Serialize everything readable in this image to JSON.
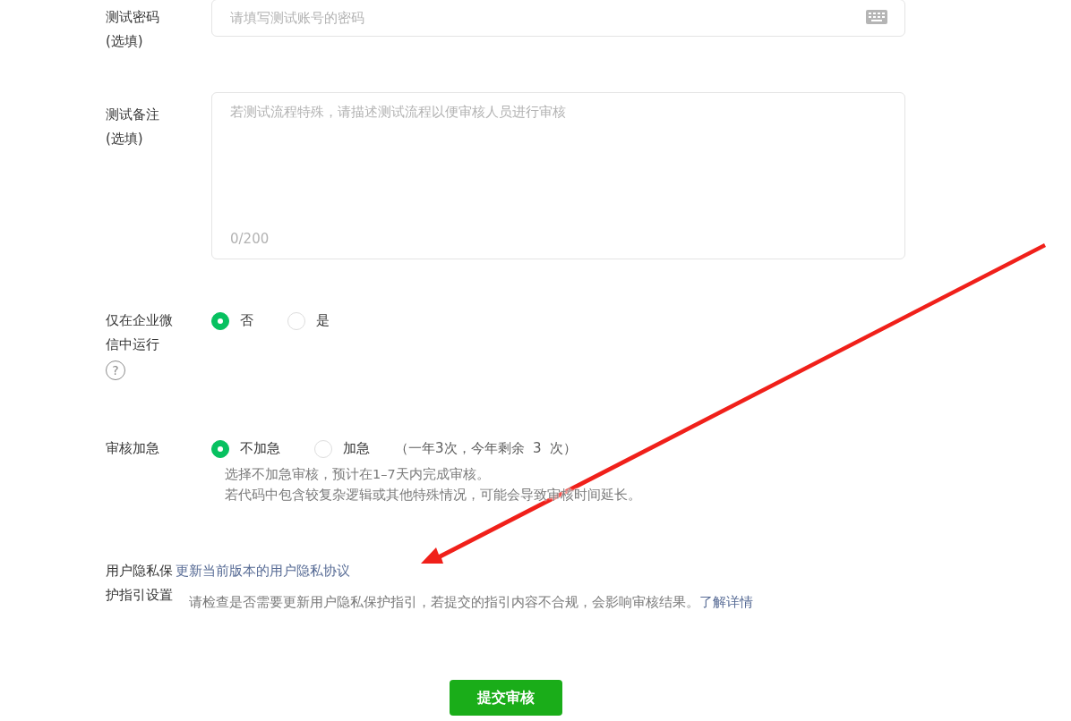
{
  "password": {
    "label": "测试密码\n(选填)",
    "placeholder": "请填写测试账号的密码"
  },
  "notes": {
    "label": "测试备注\n(选填)",
    "placeholder": "若测试流程特殊，请描述测试流程以便审核人员进行审核",
    "counter": "0/200"
  },
  "wework_only": {
    "label": "仅在企业微信中运行",
    "help_glyph": "?",
    "options": [
      {
        "label": "否",
        "selected": true
      },
      {
        "label": "是",
        "selected": false
      }
    ]
  },
  "urgent": {
    "label": "审核加急",
    "options": [
      {
        "label": "不加急",
        "selected": true
      },
      {
        "label": "加急",
        "selected": false
      }
    ],
    "quota": "（一年3次，今年剩余  3  次）",
    "hints": [
      "选择不加急审核，预计在1–7天内完成审核。",
      "若代码中包含较复杂逻辑或其他特殊情况，可能会导致审核时间延长。"
    ]
  },
  "privacy": {
    "label": "用户隐私保护指引设置",
    "link": "更新当前版本的用户隐私协议",
    "hint": "请检查是否需要更新用户隐私保护指引，若提交的指引内容不合规，会影响审核结果。",
    "hint_link": "了解详情"
  },
  "submit": "提交审核"
}
